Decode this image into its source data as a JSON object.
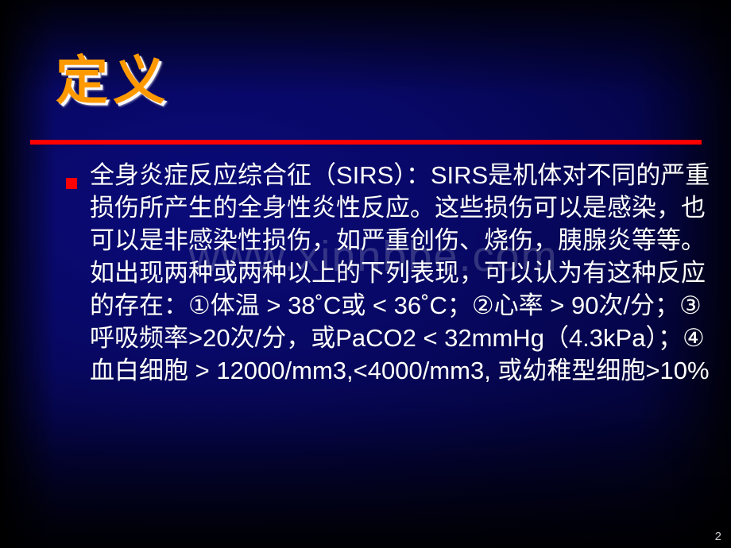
{
  "slide": {
    "title": "定义",
    "page_number": "2",
    "watermark": "www.xinnbbe.com",
    "colors": {
      "title_text": "#FF9900",
      "title_shadow": "#FFFFFF",
      "divider": "#FF0000",
      "bullet": "#FF0000",
      "body_text": "#FFFFFF",
      "background_core": "#0A0A7A",
      "background_edge": "#000008"
    },
    "bullet": {
      "marker": "red-square",
      "text": "全身炎症反应综合征（SIRS）：SIRS是机体对不同的严重损伤所产生的全身性炎性反应。这些损伤可以是感染，也可以是非感染性损伤，如严重创伤、烧伤，胰腺炎等等。如出现两种或两种以上的下列表现，可以认为有这种反应的存在：①体温 > 38˚C或 < 36˚C；②心率 > 90次/分；③呼吸频率>20次/分，或PaCO2 < 32mmHg（4.3kPa）；④血白细胞 > 12000/mm3,<4000/mm3, 或幼稚型细胞>10%"
    }
  }
}
